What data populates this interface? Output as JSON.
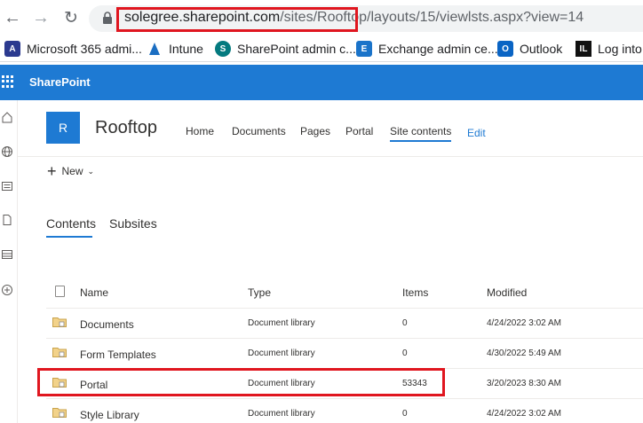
{
  "browser": {
    "url_host": "solegree.sharepoint.com",
    "url_path": "/sites/Rooftop/",
    "url_rest": "layouts/15/viewlsts.aspx?view=14",
    "bookmarks": [
      {
        "label": "Microsoft 365 admi...",
        "icon": "m365-admin-icon",
        "color": "#2b3a8f"
      },
      {
        "label": "Intune",
        "icon": "intune-icon",
        "color": "#1b6ec2"
      },
      {
        "label": "SharePoint admin c...",
        "icon": "sharepoint-icon",
        "color": "#047a7f"
      },
      {
        "label": "Exchange admin ce...",
        "icon": "exchange-icon",
        "color": "#1a73c9"
      },
      {
        "label": "Outlook",
        "icon": "outlook-icon",
        "color": "#0a64c4"
      },
      {
        "label": "Log into I",
        "icon": "lil-icon",
        "color": "#111111"
      }
    ]
  },
  "suitebar": {
    "title": "SharePoint",
    "color": "#1e7ad3"
  },
  "site": {
    "logo_letter": "R",
    "title": "Rooftop",
    "nav": [
      "Home",
      "Documents",
      "Pages",
      "Portal",
      "Site contents"
    ],
    "edit_label": "Edit"
  },
  "commandbar": {
    "new_label": "New"
  },
  "pivots": [
    "Contents",
    "Subsites"
  ],
  "table": {
    "headers": [
      "Name",
      "Type",
      "Items",
      "Modified"
    ],
    "rows": [
      {
        "name": "Documents",
        "type": "Document library",
        "items": "0",
        "modified": "4/24/2022 3:02 AM"
      },
      {
        "name": "Form Templates",
        "type": "Document library",
        "items": "0",
        "modified": "4/30/2022 5:49 AM"
      },
      {
        "name": "Portal",
        "type": "Document library",
        "items": "53343",
        "modified": "3/20/2023 8:30 AM"
      },
      {
        "name": "Style Library",
        "type": "Document library",
        "items": "0",
        "modified": "4/24/2022 3:02 AM"
      }
    ]
  },
  "highlight_color": "#e0161f"
}
